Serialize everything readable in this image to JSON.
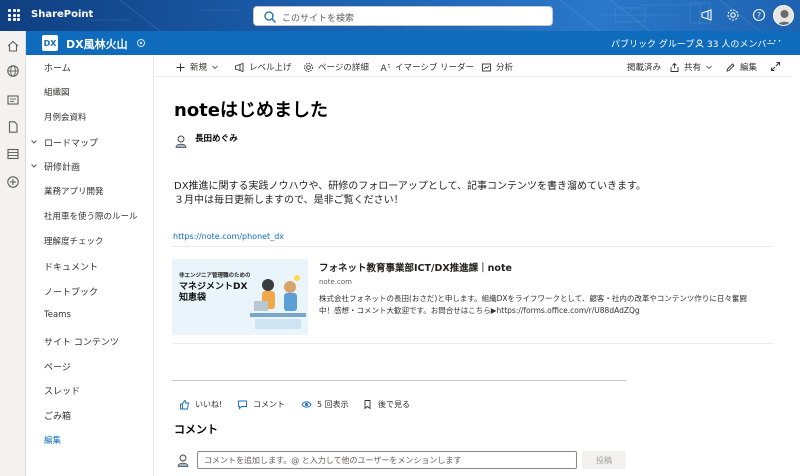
{
  "suite": {
    "brand": "SharePoint",
    "search_placeholder": "このサイトを検索"
  },
  "site": {
    "logo": "DX",
    "name": "DX風林火山",
    "group": "パブリック グループ",
    "members": "33 人のメンバー",
    "more": "···"
  },
  "nav": {
    "items": [
      {
        "label": "ホーム"
      },
      {
        "label": "組織図"
      },
      {
        "label": "月例会資料"
      },
      {
        "label": "ロードマップ"
      },
      {
        "label": "研修計画"
      },
      {
        "label": "業務アプリ開発"
      },
      {
        "label": "社用車を使う際のルール"
      },
      {
        "label": "理解度チェック"
      },
      {
        "label": "ドキュメント"
      },
      {
        "label": "ノートブック"
      },
      {
        "label": "Teams"
      },
      {
        "label": "サイト コンテンツ"
      },
      {
        "label": "ページ"
      },
      {
        "label": "スレッド"
      },
      {
        "label": "ごみ箱"
      },
      {
        "label": "編集"
      }
    ]
  },
  "commands": {
    "new": "新規",
    "promote": "レベル上げ",
    "details": "ページの詳細",
    "reader": "イマーシブ リーダー",
    "analytics": "分析",
    "published": "掲載済み",
    "share": "共有",
    "edit": "編集"
  },
  "page": {
    "title": "noteはじめました",
    "author": "長田めぐみ",
    "body_line1": "DX推進に関する実践ノウハウや、研修のフォローアップとして、記事コンテンツを書き溜めていきます。",
    "body_line2": "３月中は毎日更新しますので、是非ご覧ください！",
    "link": "https://note.com/phonet_dx"
  },
  "card": {
    "thumb_line1": "非エンジニア管理職のための",
    "thumb_title": "マネジメントDX知恵袋",
    "title": "フォネット教育事業部ICT/DX推進課｜note",
    "domain": "note.com",
    "desc": "株式会社フォネットの長田(おさだ)と申します。組織DXをライフワークとして、顧客・社内の改革やコンテンツ作りに日々奮闘中！感想・コメント大歓迎です。お問合せはこちら▶https://forms.office.com/r/U88dAdZQg"
  },
  "social": {
    "like": "いいね!",
    "comment": "コメント",
    "views": "5 回表示",
    "save": "後で見る"
  },
  "comments": {
    "heading": "コメント",
    "placeholder": "コメントを追加します。@ と入力して他のユーザーをメンションします",
    "post": "投稿"
  }
}
